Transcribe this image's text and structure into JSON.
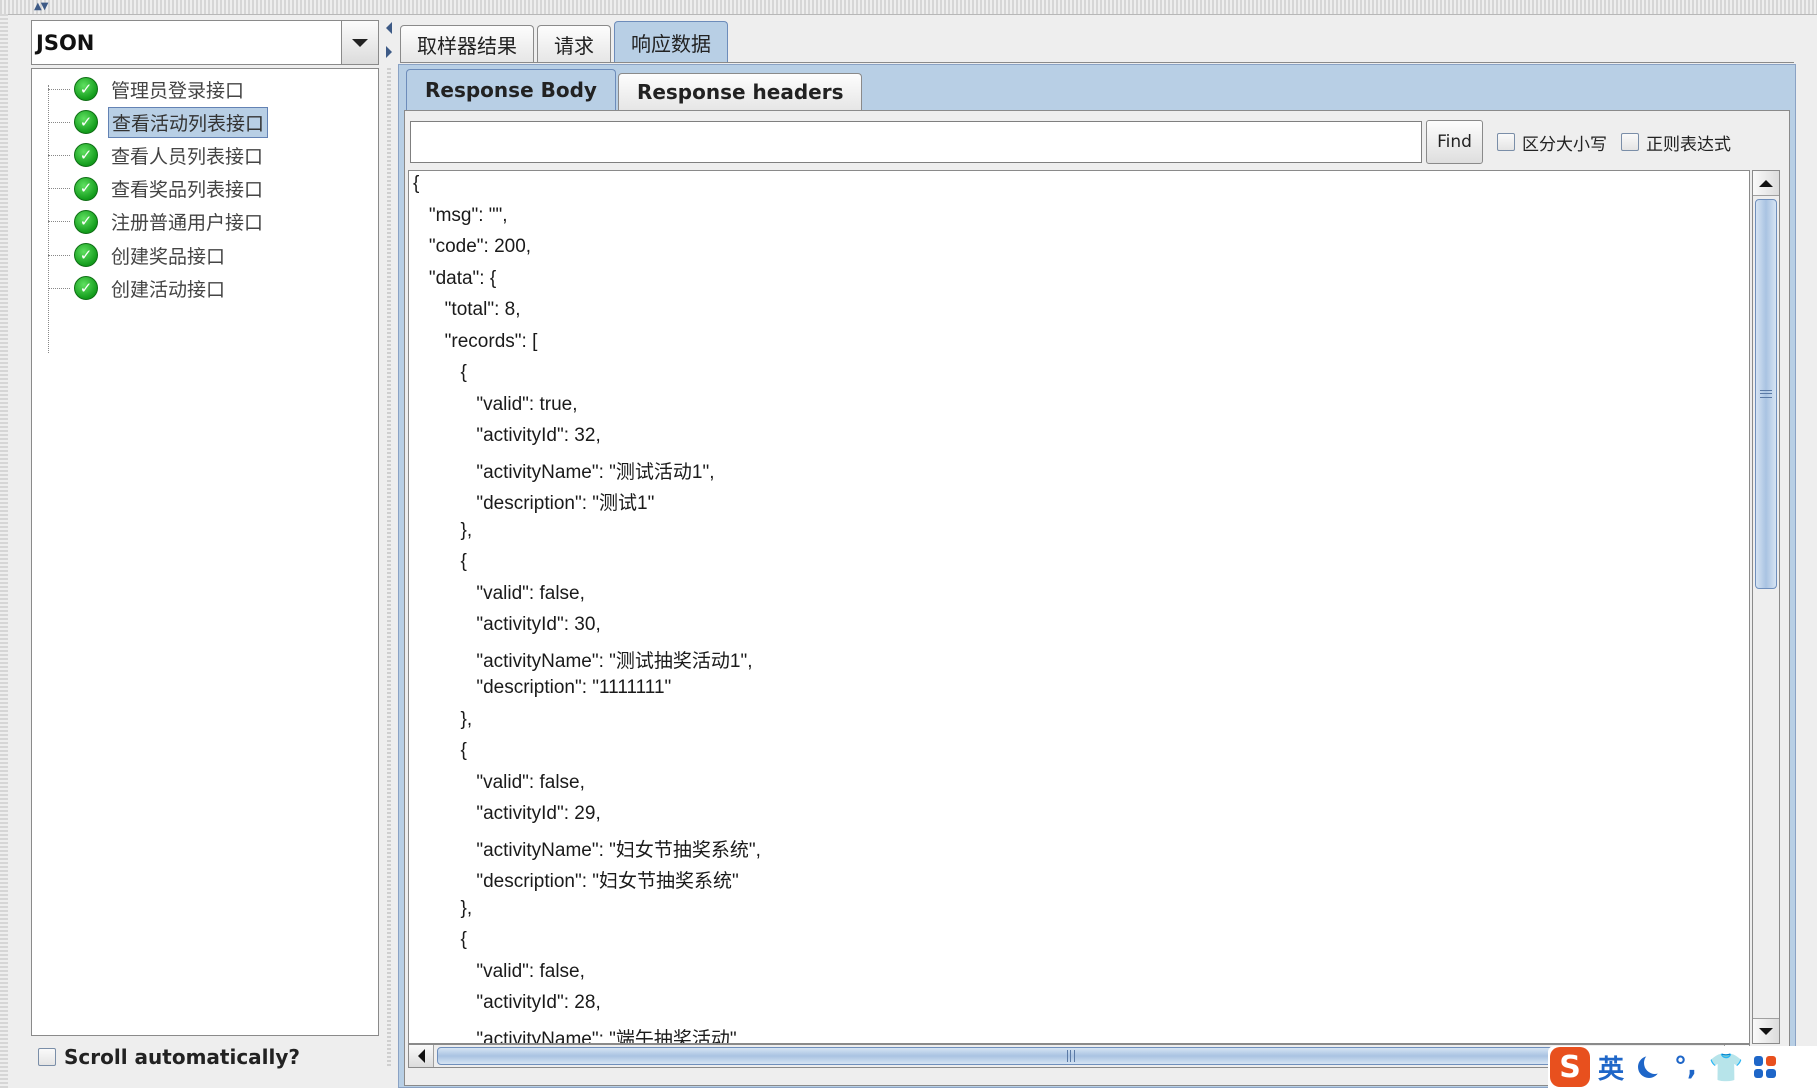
{
  "left_panel": {
    "renderer_value": "JSON",
    "tree_items": [
      {
        "label": "管理员登录接口",
        "status": "success"
      },
      {
        "label": "查看活动列表接口",
        "status": "success",
        "selected": true
      },
      {
        "label": "查看人员列表接口",
        "status": "success"
      },
      {
        "label": "查看奖品列表接口",
        "status": "success"
      },
      {
        "label": "注册普通用户接口",
        "status": "success"
      },
      {
        "label": "创建奖品接口",
        "status": "success"
      },
      {
        "label": "创建活动接口",
        "status": "success"
      }
    ],
    "scroll_auto_label": "Scroll automatically?",
    "scroll_auto_checked": false
  },
  "outer_tabs": [
    "取样器结果",
    "请求",
    "响应数据"
  ],
  "outer_active": 2,
  "inner_tabs": [
    "Response Body",
    "Response headers"
  ],
  "inner_active": 0,
  "search": {
    "value": "",
    "find_label": "Find",
    "case_label": "区分大小写",
    "regex_label": "正则表达式",
    "case_checked": false,
    "regex_checked": false
  },
  "response_lines": [
    "{",
    "   \"msg\": \"\",",
    "   \"code\": 200,",
    "   \"data\": {",
    "      \"total\": 8,",
    "      \"records\": [",
    "         {",
    "            \"valid\": true,",
    "            \"activityId\": 32,",
    "            \"activityName\": \"测试活动1\",",
    "            \"description\": \"测试1\"",
    "         },",
    "         {",
    "            \"valid\": false,",
    "            \"activityId\": 30,",
    "            \"activityName\": \"测试抽奖活动1\",",
    "            \"description\": \"1111111\"",
    "         },",
    "         {",
    "            \"valid\": false,",
    "            \"activityId\": 29,",
    "            \"activityName\": \"妇女节抽奖系统\",",
    "            \"description\": \"妇女节抽奖系统\"",
    "         },",
    "         {",
    "            \"valid\": false,",
    "            \"activityId\": 28,",
    "            \"activityName\": \"端午抽奖活动\""
  ],
  "ime": {
    "logo": "S",
    "lang": "英",
    "punct": "°,",
    "icons": [
      "moon-icon",
      "punctuation-icon",
      "skin-icon",
      "apps-grid-icon"
    ]
  },
  "colors": {
    "selection_bg": "#b8cfe5",
    "selection_border": "#6382b4",
    "success_green": "#139c1c",
    "ime_orange": "#e8501e",
    "ime_blue": "#1e66c8"
  }
}
